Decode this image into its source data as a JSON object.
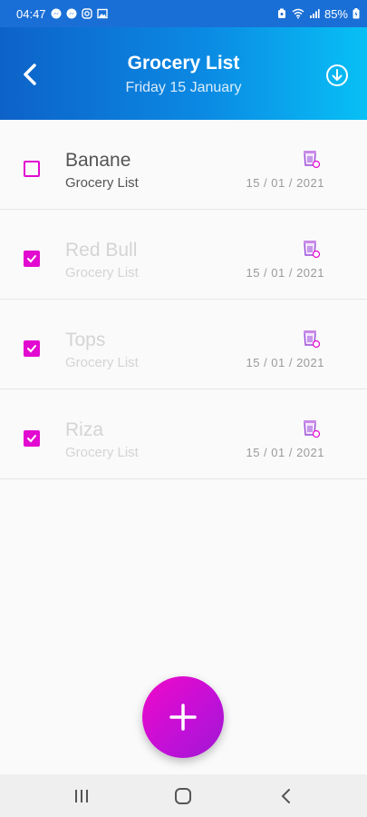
{
  "status": {
    "time": "04:47",
    "battery": "85%"
  },
  "header": {
    "title": "Grocery List",
    "subtitle": "Friday 15 January"
  },
  "items": [
    {
      "name": "Banane",
      "list": "Grocery List",
      "date": "15 / 01 / 2021",
      "checked": false
    },
    {
      "name": "Red Bull",
      "list": "Grocery List",
      "date": "15 / 01 / 2021",
      "checked": true
    },
    {
      "name": "Tops",
      "list": "Grocery List",
      "date": "15 / 01 / 2021",
      "checked": true
    },
    {
      "name": "Riza",
      "list": "Grocery List",
      "date": "15 / 01 / 2021",
      "checked": true
    }
  ],
  "icons": {
    "back": "back-arrow-icon",
    "download": "download-icon",
    "trash": "trash-icon",
    "add": "plus-icon",
    "nav_recents": "recents-icon",
    "nav_home": "home-icon",
    "nav_back": "back-icon"
  },
  "colors": {
    "accent": "#e20ad0",
    "header_start": "#0d62c8",
    "header_end": "#08c0f5"
  }
}
